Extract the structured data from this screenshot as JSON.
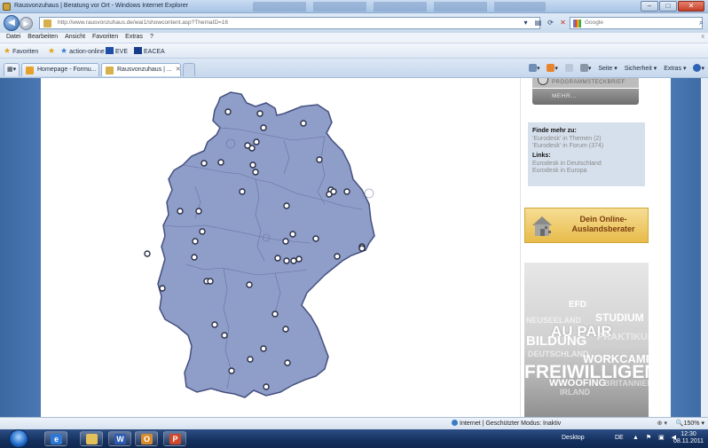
{
  "window": {
    "title": "Rausvonzuhaus | Beratung vor Ort - Windows Internet Explorer",
    "minimize": "–",
    "maximize": "□",
    "close": "✕"
  },
  "address": {
    "url": "http://www.rausvonzuhaus.de/wai1/showcontent.asp?ThemaID=16",
    "search_placeholder": "Google"
  },
  "menu": {
    "items": [
      "Datei",
      "Bearbeiten",
      "Ansicht",
      "Favoriten",
      "Extras",
      "?"
    ],
    "right": "x"
  },
  "favorites": {
    "favoriten": "Favoriten",
    "items": [
      "action-online",
      "EVE",
      "EACEA"
    ]
  },
  "tabs": [
    {
      "label": "Homepage - Formu..."
    },
    {
      "label": "Rausvonzuhaus | ..."
    }
  ],
  "commandbar": {
    "seite": "Seite ▾",
    "sicherheit": "Sicherheit ▾",
    "extras": "Extras ▾"
  },
  "sidebar": {
    "mehr_top": "PROGRAMMSTECKBRIEF",
    "mehr": "MEHR...",
    "finde_heading": "Finde mehr zu:",
    "finde_links": [
      "'Eurodesk' in Themen (2)",
      "'Eurodesk' in Forum (374)"
    ],
    "links_heading": "Links:",
    "links": [
      "Eurodesk in Deutschland",
      "Eurodesk in Europa"
    ],
    "berater_line1": "Dein Online-",
    "berater_line2": "Auslandsberater",
    "cloud_words": [
      {
        "text": "EFD",
        "color": "#ffffff"
      },
      {
        "text": "STUDIUM",
        "color": "#ffffff"
      },
      {
        "text": "NEUSEELAND",
        "color": "#f4f4f4"
      },
      {
        "text": "AU PAIR",
        "color": "#ffffff"
      },
      {
        "text": "BILDUNG",
        "color": "#ffffff"
      },
      {
        "text": "PRAKTIKUM",
        "color": "#efefef"
      },
      {
        "text": "DEUTSCHLAND",
        "color": "#f4f4f4"
      },
      {
        "text": "WORKCAMP",
        "color": "#ffffff"
      },
      {
        "text": "FREIWILLIGENDIENSTE",
        "color": "#ffffff"
      },
      {
        "text": "WWOOFING",
        "color": "#ffffff"
      },
      {
        "text": "IRLAND",
        "color": "#e6e6e6"
      },
      {
        "text": "BRITANNIEN",
        "color": "#e6e6e6"
      }
    ]
  },
  "status": {
    "zone": "Internet | Geschützter Modus: Inaktiv",
    "zoom": "150%"
  },
  "taskbar": {
    "desktop": "Desktop",
    "lang": "DE",
    "time": "12:30",
    "date": "08.11.2011"
  },
  "map": {
    "fill": "#8f9dc9",
    "stroke": "#44507e",
    "dot_count": 47
  }
}
